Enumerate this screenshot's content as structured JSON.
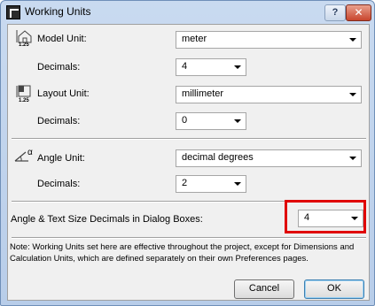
{
  "window": {
    "title": "Working Units",
    "help_glyph": "?",
    "close_glyph": "✕"
  },
  "units": {
    "model": {
      "label": "Model Unit:",
      "icon_caption": "1.25",
      "value": "meter",
      "decimals_label": "Decimals:",
      "decimals_value": "4"
    },
    "layout": {
      "label": "Layout Unit:",
      "icon_caption": "1.25",
      "value": "millimeter",
      "decimals_label": "Decimals:",
      "decimals_value": "0"
    },
    "angle": {
      "label": "Angle Unit:",
      "icon_caption": "α",
      "value": "decimal degrees",
      "decimals_label": "Decimals:",
      "decimals_value": "2"
    }
  },
  "dialog_decimals": {
    "label": "Angle & Text Size Decimals in Dialog Boxes:",
    "value": "4"
  },
  "note": "Note: Working Units set here are effective throughout the project, except for Dimensions and Calculation Units, which are defined separately on their own Preferences pages.",
  "buttons": {
    "cancel": "Cancel",
    "ok": "OK"
  },
  "colors": {
    "highlight": "#e00000",
    "window_frame": "#b8cde9"
  },
  "icons": [
    "app-icon",
    "help-icon",
    "close-icon",
    "model-unit-icon",
    "layout-unit-icon",
    "angle-unit-icon",
    "dropdown-arrow-icon"
  ]
}
